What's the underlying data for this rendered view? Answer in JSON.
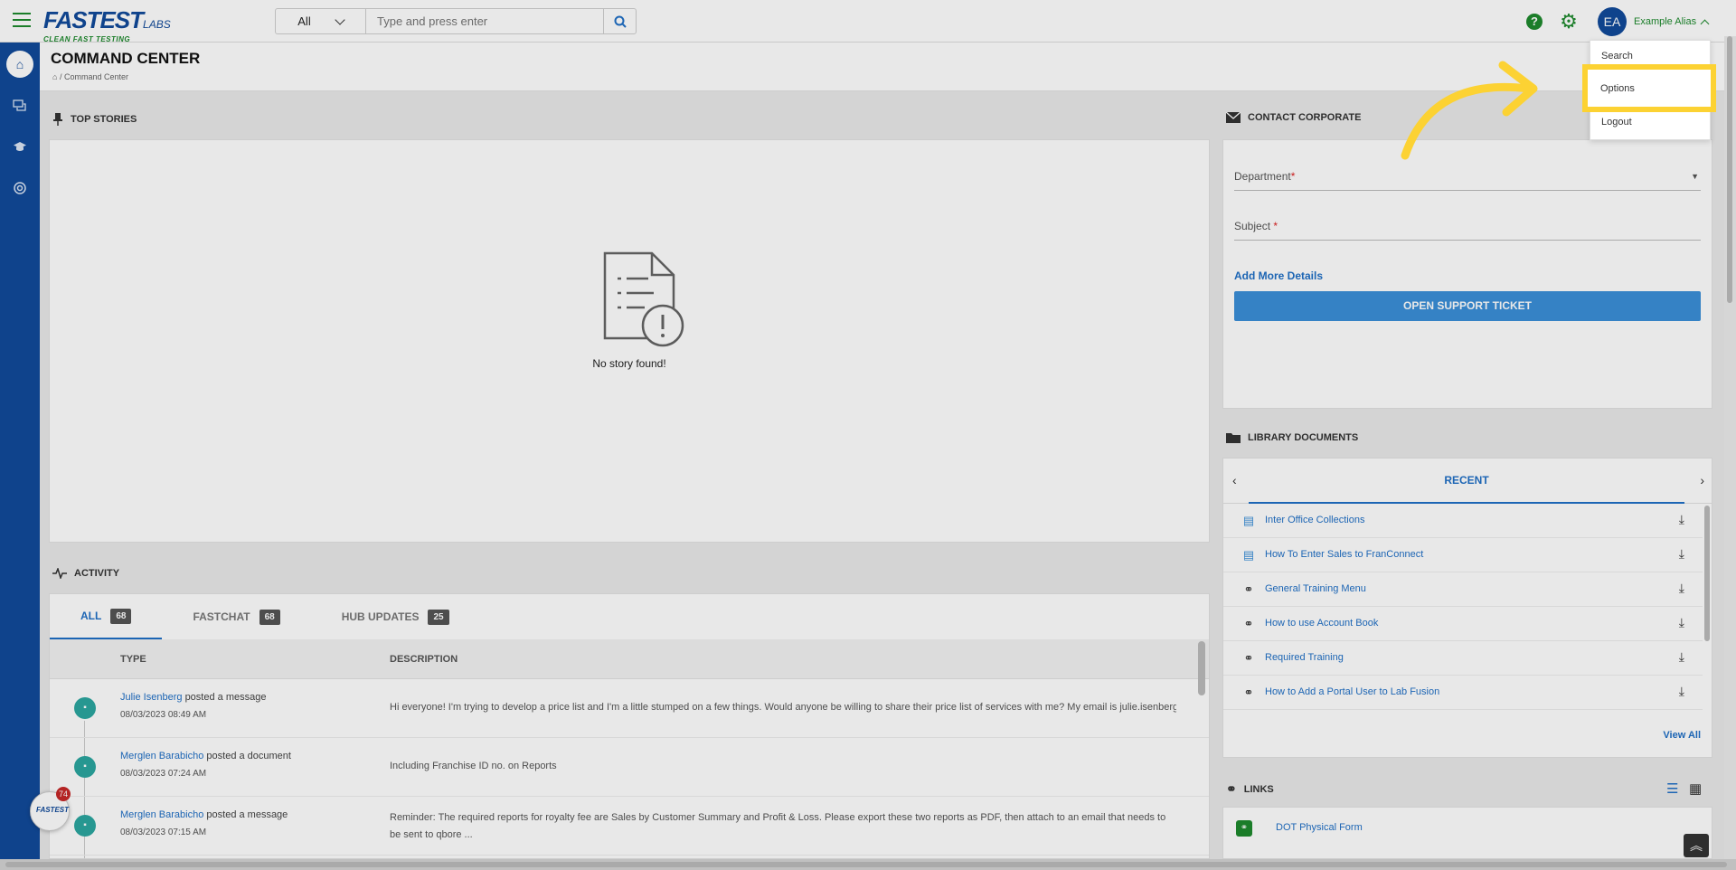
{
  "app": {
    "logo_text": "FASTEST",
    "logo_suffix": "LABS",
    "logo_tagline": "CLEAN FAST TESTING"
  },
  "search": {
    "scope": "All",
    "placeholder": "Type and press enter"
  },
  "user": {
    "initials": "EA",
    "alias": "Example Alias"
  },
  "user_menu": {
    "items": [
      "Search",
      "Options",
      "Logout"
    ],
    "highlighted": "Options"
  },
  "page": {
    "title": "COMMAND CENTER",
    "breadcrumb": "/ Command Center"
  },
  "top_stories": {
    "heading": "TOP STORIES",
    "empty_message": "No story found!"
  },
  "activity": {
    "heading": "ACTIVITY",
    "tabs": [
      {
        "label": "ALL",
        "count": "68"
      },
      {
        "label": "FASTCHAT",
        "count": "68"
      },
      {
        "label": "HUB UPDATES",
        "count": "25"
      }
    ],
    "columns": [
      "TYPE",
      "DESCRIPTION"
    ],
    "rows": [
      {
        "user": "Julie Isenberg",
        "action": "posted a message",
        "time": "08/03/2023 08:49 AM",
        "description": "Hi everyone! I'm trying to develop a price list and I'm a little stumped on a few things. Would anyone be willing to share their price list of services with me? My email is julie.isenberg@fas ..."
      },
      {
        "user": "Merglen Barabicho",
        "action": "posted a document",
        "time": "08/03/2023 07:24 AM",
        "description": "Including Franchise ID no. on Reports"
      },
      {
        "user": "Merglen Barabicho",
        "action": "posted a message",
        "time": "08/03/2023 07:15 AM",
        "description": "Reminder: The required reports for royalty fee are Sales by Customer Summary and Profit & Loss. Please export these two reports as PDF, then attach to an email that needs to be sent to qbore ..."
      }
    ]
  },
  "contact": {
    "heading": "CONTACT CORPORATE",
    "department_label": "Department",
    "subject_label": "Subject",
    "required_mark": "*",
    "add_more": "Add More Details",
    "submit": "OPEN SUPPORT TICKET"
  },
  "library": {
    "heading": "LIBRARY DOCUMENTS",
    "tab": "RECENT",
    "items": [
      {
        "name": "Inter Office Collections",
        "icon": "document-icon"
      },
      {
        "name": "How To Enter Sales to FranConnect",
        "icon": "document-icon"
      },
      {
        "name": "General Training Menu",
        "icon": "link-icon"
      },
      {
        "name": "How to use Account Book",
        "icon": "link-icon"
      },
      {
        "name": "Required Training",
        "icon": "link-icon"
      },
      {
        "name": "How to Add a Portal User to Lab Fusion",
        "icon": "link-icon"
      }
    ],
    "view_all": "View All"
  },
  "links": {
    "heading": "LINKS",
    "items": [
      "DOT Physical Form"
    ]
  },
  "chat": {
    "badge_count": "74"
  },
  "colors": {
    "brand_blue": "#114a9a",
    "brand_green": "#1e8a2e",
    "link_blue": "#1f6fc6",
    "highlight_yellow": "#fcd233"
  }
}
